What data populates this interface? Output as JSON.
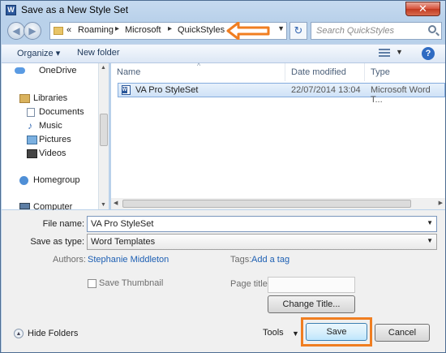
{
  "window": {
    "title": "Save as a New Style Set",
    "app_icon": "W",
    "close_glyph": "✕"
  },
  "nav": {
    "back_glyph": "◀",
    "forward_glyph": "▶",
    "breadcrumb_prefix": "«",
    "crumbs": [
      "Roaming",
      "Microsoft",
      "QuickStyles"
    ],
    "crumb_sep": "▸",
    "dropdown_glyph": "▼",
    "refresh_glyph": "↻",
    "search_placeholder": "Search QuickStyles",
    "callout_color": "#f07e21"
  },
  "toolbar": {
    "organize": "Organize ▾",
    "new_folder": "New folder",
    "view_drop": "▼",
    "help": "?"
  },
  "sidebar": {
    "items": [
      {
        "label": "OneDrive",
        "icon": "cloud-icon"
      },
      {
        "label": "Libraries",
        "icon": "library-icon"
      },
      {
        "label": "Documents",
        "icon": "documents-icon"
      },
      {
        "label": "Music",
        "icon": "music-icon"
      },
      {
        "label": "Pictures",
        "icon": "pictures-icon"
      },
      {
        "label": "Videos",
        "icon": "videos-icon"
      },
      {
        "label": "Homegroup",
        "icon": "homegroup-icon"
      },
      {
        "label": "Computer",
        "icon": "computer-icon"
      }
    ],
    "scroll_up": "▲",
    "scroll_down": "▼"
  },
  "files": {
    "columns": [
      "Name",
      "Date modified",
      "Type"
    ],
    "sort_indicator": "^",
    "rows": [
      {
        "name": "VA Pro StyleSet",
        "date": "22/07/2014 13:04",
        "type": "Microsoft Word T..."
      }
    ],
    "scroll_left": "◀",
    "scroll_right": "▶"
  },
  "form": {
    "file_name_label": "File name:",
    "file_name_value": "VA Pro StyleSet",
    "save_type_label": "Save as type:",
    "save_type_value": "Word Templates",
    "authors_label": "Authors:",
    "authors_value": "Stephanie Middleton",
    "tags_label": "Tags:",
    "tags_value": "Add a tag",
    "thumbnail_label": "Save Thumbnail",
    "page_title_label": "Page title:",
    "change_title_button": "Change Title...",
    "dropdown_glyph": "▼"
  },
  "footer": {
    "hide_folders": "Hide Folders",
    "hide_folders_glyph": "▲",
    "tools": "Tools",
    "tools_drop": "▼",
    "save": "Save",
    "cancel": "Cancel",
    "highlight_color": "#f07e21"
  }
}
